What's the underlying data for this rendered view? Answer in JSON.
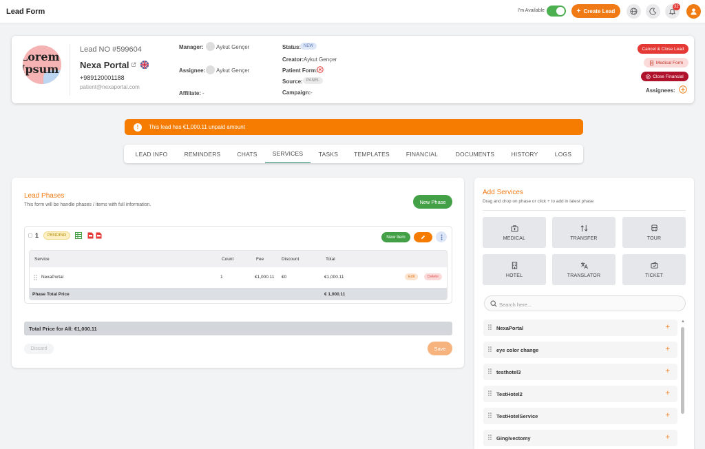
{
  "header": {
    "title": "Lead Form",
    "availability_label": "I'm Available",
    "create_lead_label": "Create Lead",
    "notification_count": "32"
  },
  "lead": {
    "avatar_text_line1": "Lorem",
    "avatar_text_line2": "Ipsum",
    "lead_no": "Lead NO #599604",
    "name": "Nexa Portal",
    "phone": "+989120001188",
    "email": "patient@nexaportal.com",
    "manager_label": "Manager:",
    "manager_value": "Aykut Gençer",
    "assignee_label": "Assignee:",
    "assignee_value": "Aykut Gençer",
    "affiliate_label": "Affiliate:",
    "affiliate_value": "-",
    "status_label": "Status:",
    "status_value": "NEW",
    "creator_label": "Creator:",
    "creator_value": "Aykut Gençer",
    "patient_form_label": "Patient Form:",
    "source_label": "Source:",
    "source_value": "PANEL",
    "campaign_label": "Campaign:",
    "campaign_value": "-",
    "cancel_close_label": "Cancel & Close Lead",
    "medical_form_label": "Medical Form",
    "close_financial_label": "Close Financial",
    "assignees_label": "Assignees:"
  },
  "alert": {
    "text": "This lead has €1,000.11 unpaid amount"
  },
  "tabs": [
    {
      "label": "LEAD INFO"
    },
    {
      "label": "REMINDERS"
    },
    {
      "label": "CHATS"
    },
    {
      "label": "SERVICES"
    },
    {
      "label": "TASKS"
    },
    {
      "label": "TEMPLATES"
    },
    {
      "label": "FINANCIAL"
    },
    {
      "label": "DOCUMENTS"
    },
    {
      "label": "HISTORY"
    },
    {
      "label": "LOGS"
    }
  ],
  "phases": {
    "title": "Lead Phases",
    "subtitle": "This form will be handle phases / items with full information.",
    "new_phase_label": "New Phase",
    "phase_number": "1",
    "phase_status": "PENDING",
    "new_item_label": "New Item",
    "columns": [
      "Service",
      "Count",
      "Fee",
      "Discount",
      "Total"
    ],
    "rows": [
      {
        "service": "NexaPortal",
        "count": "1",
        "fee": "€1,000.11",
        "discount": "€0",
        "total": "€1,000.11",
        "edit": "Edit",
        "delete": "Delete"
      }
    ],
    "phase_total_label": "Phase Total Price",
    "phase_total_value": "€ 1,000.11",
    "total_all": "Total Price for All:  €1,000.11",
    "discard_label": "Discard",
    "save_label": "Save"
  },
  "add_services": {
    "title": "Add Services",
    "subtitle": "Drag and drop on phase or click + to add in latest phase",
    "categories": [
      {
        "label": "MEDICAL",
        "icon": "medical-bag-icon"
      },
      {
        "label": "TRANSFER",
        "icon": "transfer-icon"
      },
      {
        "label": "TOUR",
        "icon": "bus-icon"
      },
      {
        "label": "HOTEL",
        "icon": "hotel-icon"
      },
      {
        "label": "TRANSLATOR",
        "icon": "translate-icon"
      },
      {
        "label": "TICKET",
        "icon": "ticket-icon"
      }
    ],
    "search_placeholder": "Search here...",
    "items": [
      {
        "name": "NexaPortal"
      },
      {
        "name": "eye color change"
      },
      {
        "name": "testhotel3"
      },
      {
        "name": "TestHotel2"
      },
      {
        "name": "TestHotelService"
      },
      {
        "name": "Gingivectomy"
      }
    ]
  },
  "colors": {
    "accent": "#f07b16",
    "green": "#43a047",
    "danger": "#e53935",
    "dark_red": "#b0122c"
  }
}
